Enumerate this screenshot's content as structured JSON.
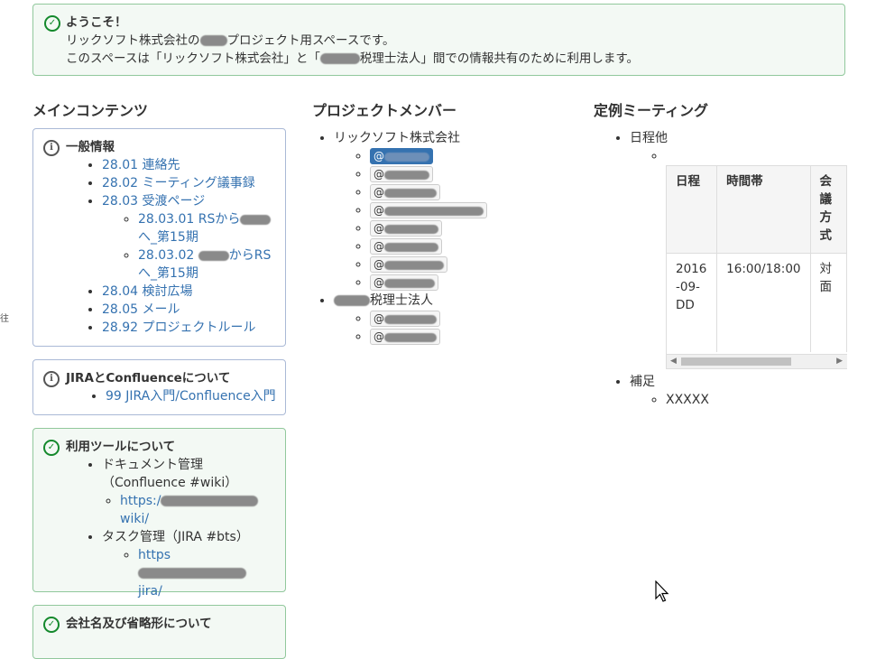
{
  "welcome": {
    "title": "ようこそ！",
    "line1_pre": "リックソフト株式会社の",
    "line1_post": "プロジェクト用スペースです。",
    "line2_pre": "このスペースは「リックソフト株式会社」と「",
    "line2_post": "税理士法人」間での情報共有のために利用します。"
  },
  "columns": {
    "main": "メインコンテンツ",
    "members": "プロジェクトメンバー",
    "meeting": "定例ミーティング"
  },
  "general": {
    "title": "一般情報",
    "items": [
      "28.01 連絡先",
      "28.02 ミーティング議事録",
      "28.03 受渡ページ",
      "28.04 検討広場",
      "28.05 メール",
      "28.92 プロジェクトルール"
    ],
    "sub1_pre": "28.03.01 RSから",
    "sub1_post": "へ_第15期",
    "sub2_pre": "28.03.02 ",
    "sub2_post": "からRSへ_第15期"
  },
  "jira": {
    "title": "JIRAとConfluenceについて",
    "link": "99 JIRA入門/Confluence入門"
  },
  "tools": {
    "title": "利用ツールについて",
    "doc": "ドキュメント管理（Confluence #wiki）",
    "doc_url_pre": "https:/",
    "doc_url_post": "wiki/",
    "task": "タスク管理（JIRA #bts）",
    "task_url_pre": "https",
    "task_url_post": "jira/"
  },
  "company_panel": {
    "title": "会社名及び省略形について"
  },
  "members": {
    "company1": "リックソフト株式会社",
    "company2_post": "税理士法人",
    "mention_prefix": "@"
  },
  "meeting": {
    "schedule": "日程他",
    "headers": [
      "日程",
      "時間帯",
      "会議方式"
    ],
    "row": [
      "2016-09-DD",
      "16:00/18:00",
      "対面"
    ],
    "supplement": "補足",
    "supplement_item": "XXXXX"
  },
  "edge_glyph": "往"
}
